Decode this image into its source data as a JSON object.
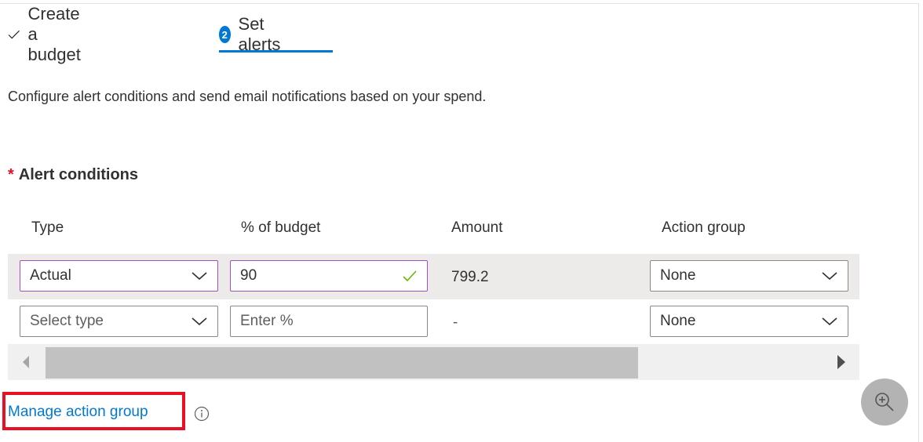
{
  "wizard": {
    "steps": [
      {
        "label": "Create a budget",
        "state": "completed",
        "icon": "check-icon"
      },
      {
        "number": "2",
        "label": "Set alerts",
        "state": "active"
      }
    ]
  },
  "description": "Configure alert conditions and send email notifications based on your spend.",
  "alert_conditions": {
    "title": "Alert conditions",
    "required_marker": "*",
    "columns": [
      "Type",
      "% of budget",
      "Amount",
      "Action group"
    ],
    "rows": [
      {
        "type": "Actual",
        "type_placeholder": "Select type",
        "percent": "90",
        "percent_placeholder": "Enter %",
        "percent_valid": true,
        "amount": "799.2",
        "action_group": "None"
      },
      {
        "type": "",
        "type_placeholder": "Select type",
        "percent": "",
        "percent_placeholder": "Enter %",
        "percent_valid": false,
        "amount": "-",
        "action_group": "None"
      }
    ]
  },
  "links": {
    "manage_action_group": "Manage action group"
  },
  "colors": {
    "accent": "#0078d4",
    "required": "#e81123",
    "valid_check": "#6bb700",
    "focus_border": "#a34fbf",
    "highlight_box": "#e81123"
  },
  "fab": {
    "icon": "zoom-in-icon"
  }
}
